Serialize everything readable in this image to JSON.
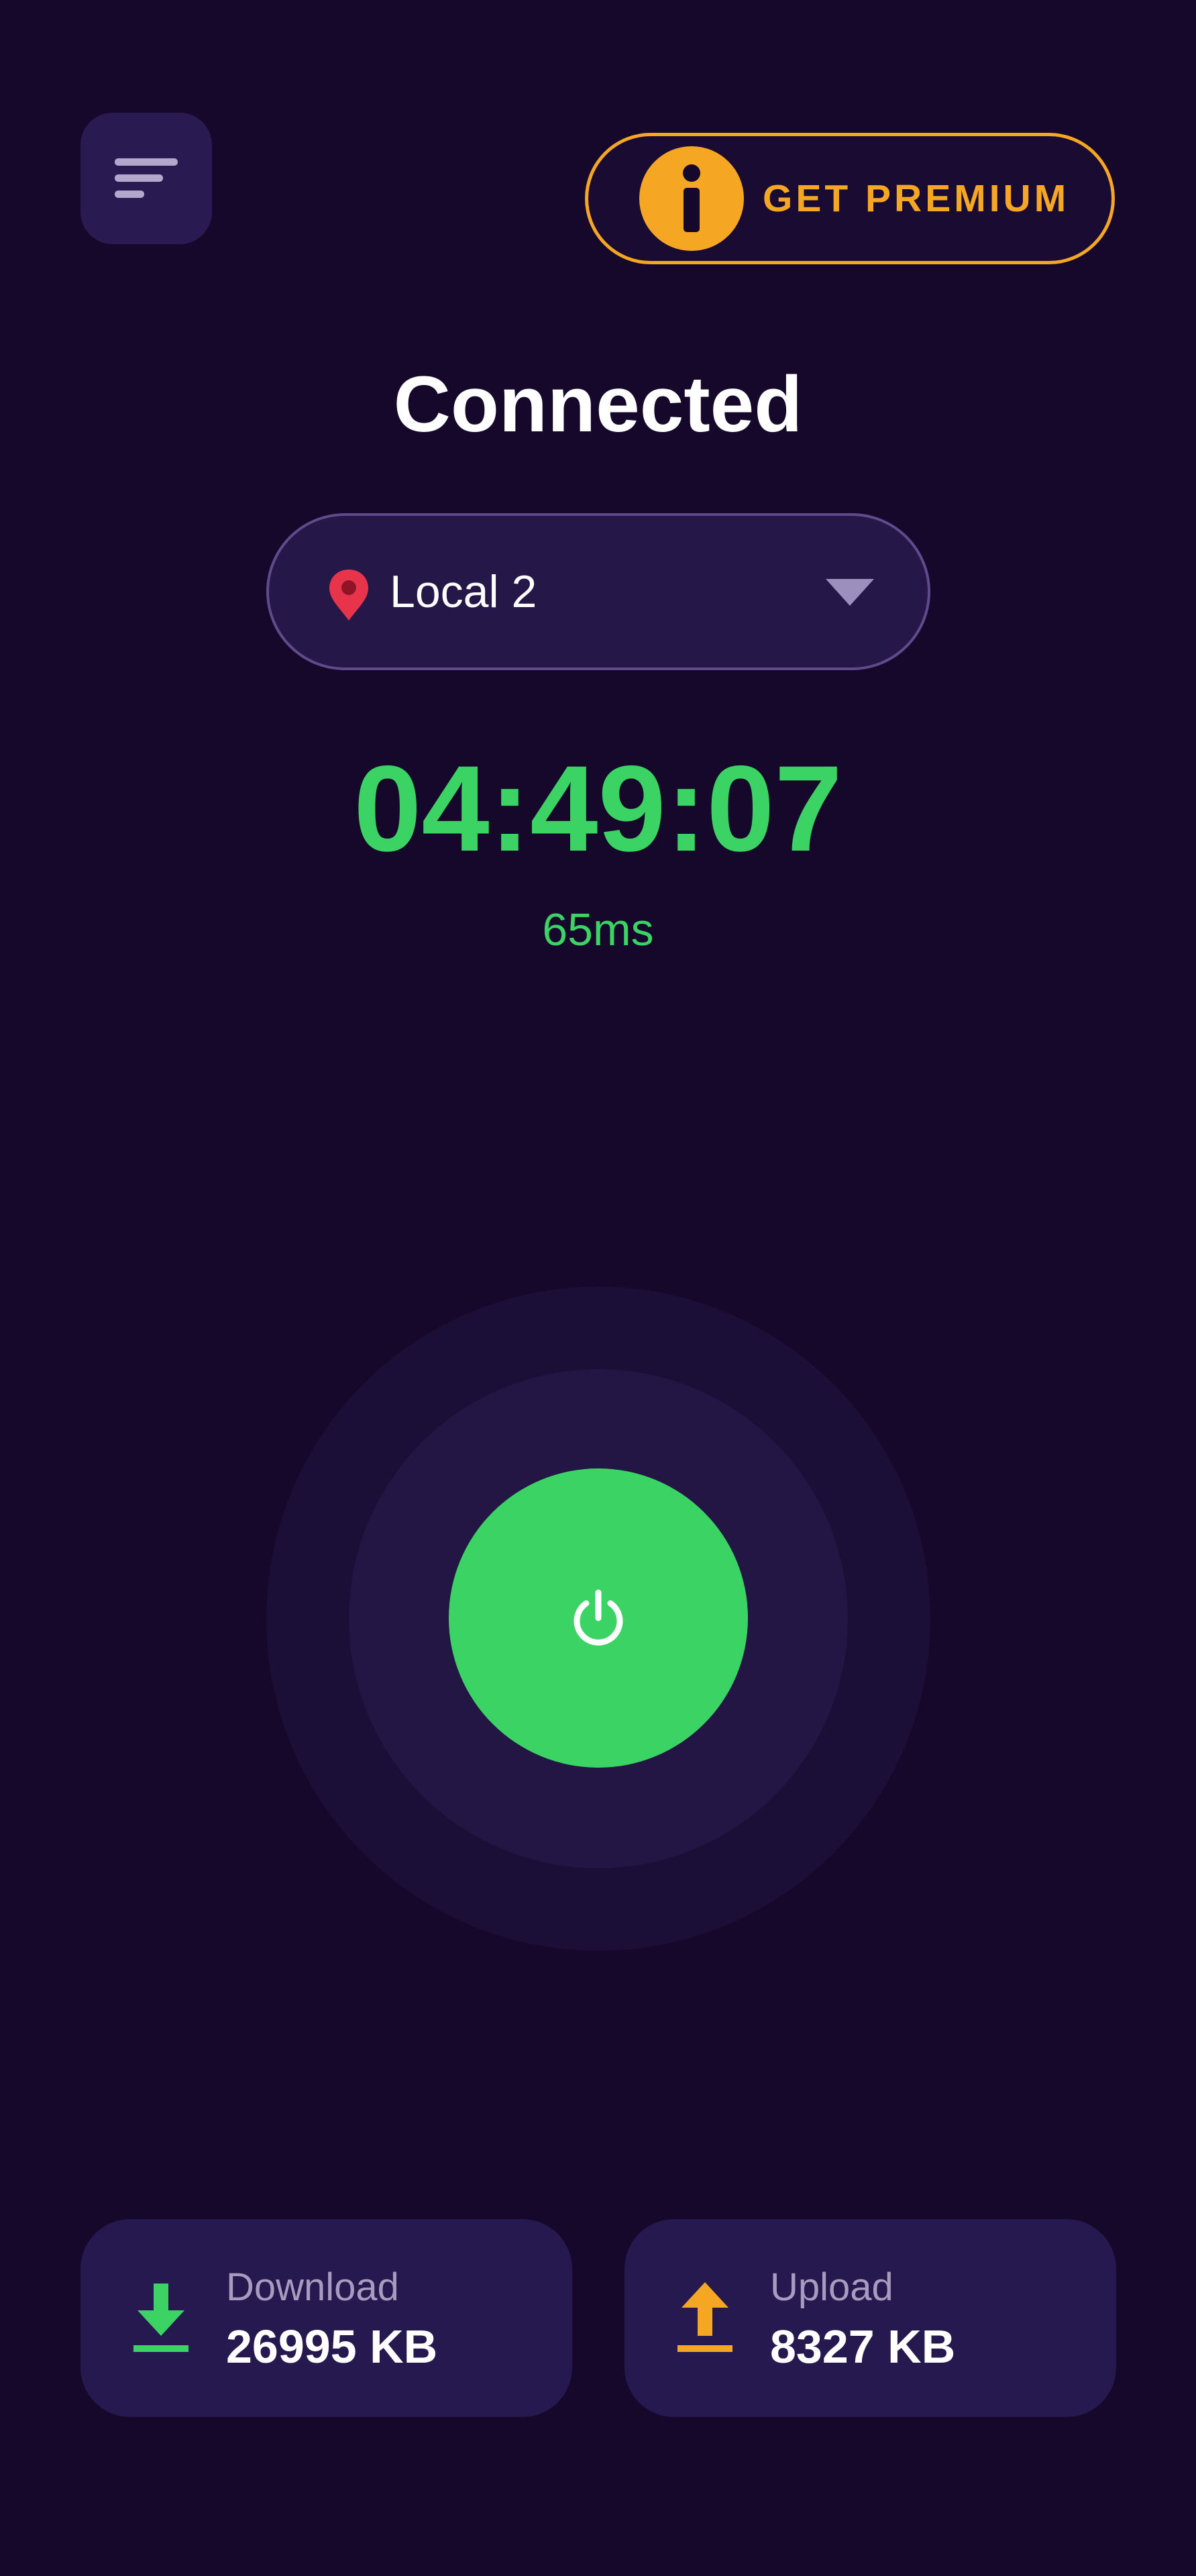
{
  "header": {
    "menu_icon": "menu-lines-icon",
    "premium": {
      "label": "GET PREMIUM",
      "icon": "info-icon",
      "accent_color": "#f5a623"
    }
  },
  "status": {
    "title": "Connected",
    "timer": "04:49:07",
    "ping": "65ms",
    "color": "#3bd364"
  },
  "location": {
    "value": "Local 2",
    "icon": "location-pin-icon",
    "dropdown_icon": "chevron-down-icon"
  },
  "power_button": {
    "icon": "power-icon",
    "color": "#3bd364"
  },
  "stats": {
    "download": {
      "label": "Download",
      "value": "26995 KB",
      "icon": "download-arrow-icon",
      "color": "#3bd364"
    },
    "upload": {
      "label": "Upload",
      "value": "8327 KB",
      "icon": "upload-arrow-icon",
      "color": "#f5a623"
    }
  },
  "colors": {
    "background": "#15082b",
    "card": "#261950"
  }
}
